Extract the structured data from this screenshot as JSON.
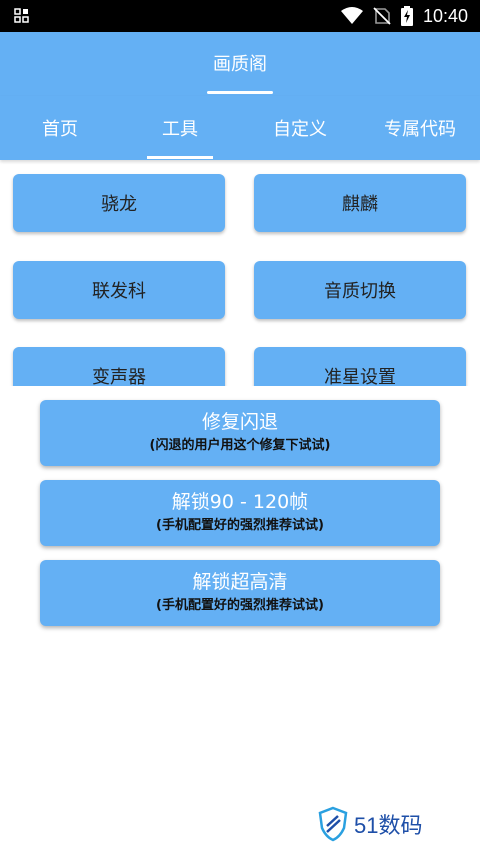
{
  "status_bar": {
    "time": "10:40",
    "icons": [
      "grid-icon",
      "wifi-icon",
      "no-sim-icon",
      "battery-charging-icon"
    ]
  },
  "app_bar": {
    "title": "画质阁"
  },
  "tabs": [
    {
      "label": "首页",
      "selected": false
    },
    {
      "label": "工具",
      "selected": true
    },
    {
      "label": "自定义",
      "selected": false
    },
    {
      "label": "专属代码",
      "selected": false
    }
  ],
  "grid_buttons": [
    {
      "label": "骁龙"
    },
    {
      "label": "麒麟"
    },
    {
      "label": "联发科"
    },
    {
      "label": "音质切换"
    },
    {
      "label": "变声器"
    },
    {
      "label": "准星设置"
    }
  ],
  "action_buttons": [
    {
      "title": "修复闪退",
      "subtitle": "(闪退的用户用这个修复下试试)"
    },
    {
      "title": "解锁90 - 120帧",
      "subtitle": "(手机配置好的强烈推荐试试)"
    },
    {
      "title": "解锁超高清",
      "subtitle": "(手机配置好的强烈推荐试试)"
    }
  ],
  "watermark": {
    "text": "51数码"
  },
  "colors": {
    "primary": "#64b0f4",
    "status_bar": "#000000",
    "watermark": "#1e4fa8"
  }
}
